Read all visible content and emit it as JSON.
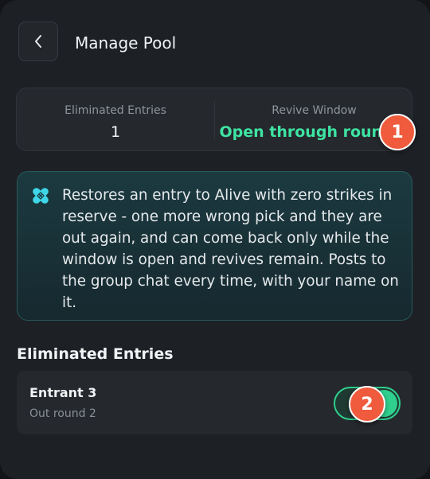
{
  "header": {
    "title": "Manage Pool"
  },
  "stats": {
    "eliminated_label": "Eliminated Entries",
    "eliminated_value": "1",
    "revive_label": "Revive Window",
    "revive_value": "Open through round 8"
  },
  "info": {
    "text": "Restores an entry to Alive with zero strikes in reserve - one more wrong pick and they are out again, and can come back only while the window is open and revives remain. Posts to the group chat every time, with your name on it."
  },
  "section": {
    "title": "Eliminated Entries"
  },
  "entries": [
    {
      "name": "Entrant 3",
      "status": "Out round 2",
      "revive_toggle_on": true
    }
  ],
  "badges": [
    "1",
    "2"
  ],
  "colors": {
    "accent_green": "#3ee4a3",
    "badge": "#ef5b3c",
    "info_bg": "#1b3a40",
    "icon_cyan": "#3fd6e8"
  }
}
